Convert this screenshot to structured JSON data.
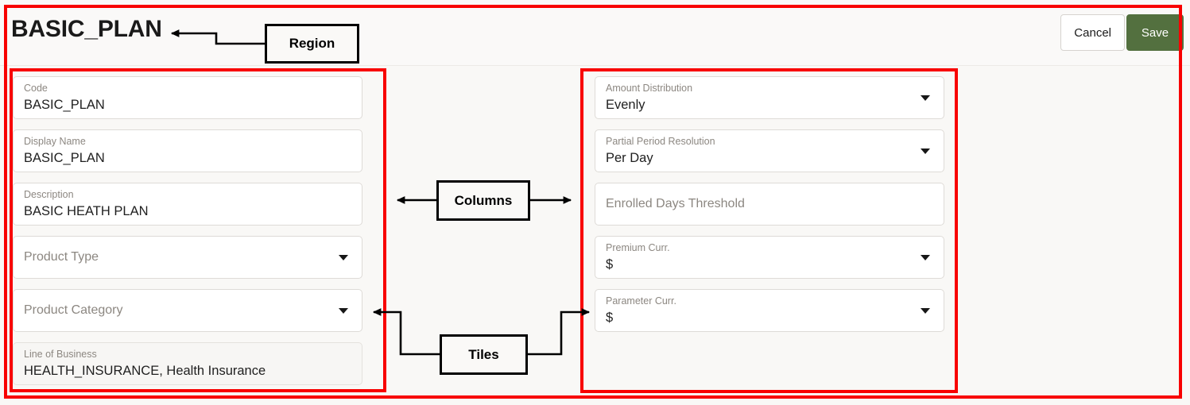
{
  "header": {
    "title": "BASIC_PLAN",
    "cancel_label": "Cancel",
    "save_label": "Save",
    "save_color": "#53703f"
  },
  "left_column": {
    "fields": [
      {
        "label": "Code",
        "value": "BASIC_PLAN",
        "type": "text",
        "placeholder": ""
      },
      {
        "label": "Display Name",
        "value": "BASIC_PLAN",
        "type": "text",
        "placeholder": ""
      },
      {
        "label": "Description",
        "value": "BASIC HEATH PLAN",
        "type": "text",
        "placeholder": ""
      },
      {
        "label": "",
        "value": "",
        "type": "select",
        "placeholder": "Product Type"
      },
      {
        "label": "",
        "value": "",
        "type": "select",
        "placeholder": "Product Category"
      },
      {
        "label": "Line of Business",
        "value": "HEALTH_INSURANCE, Health Insurance",
        "type": "readonly",
        "placeholder": ""
      }
    ]
  },
  "right_column": {
    "fields": [
      {
        "label": "Amount Distribution",
        "value": "Evenly",
        "type": "select",
        "placeholder": ""
      },
      {
        "label": "Partial Period Resolution",
        "value": "Per Day",
        "type": "select",
        "placeholder": ""
      },
      {
        "label": "",
        "value": "",
        "type": "text",
        "placeholder": "Enrolled Days Threshold"
      },
      {
        "label": "Premium Curr.",
        "value": "$",
        "type": "select",
        "placeholder": ""
      },
      {
        "label": "Parameter Curr.",
        "value": "$",
        "type": "select",
        "placeholder": ""
      }
    ]
  },
  "annotations": {
    "highlight_color": "#f80000",
    "callouts": [
      {
        "label": "Region",
        "target": "page-header-region"
      },
      {
        "label": "Columns",
        "target": "left-and-right-columns"
      },
      {
        "label": "Tiles",
        "target": "field-tiles"
      }
    ]
  }
}
